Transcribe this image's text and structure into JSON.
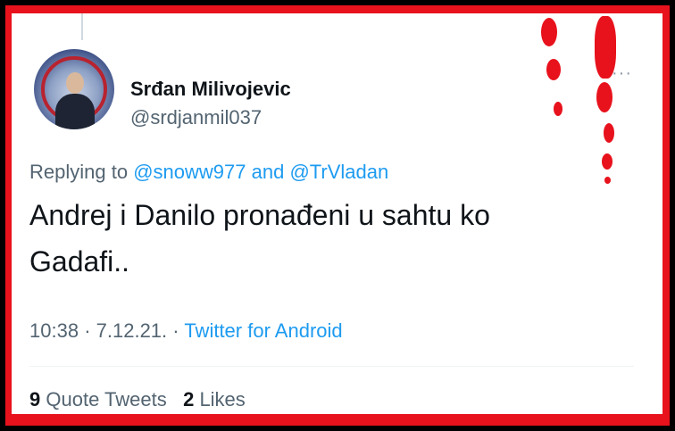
{
  "tweet": {
    "author_name": "Srđan Milivojevic",
    "author_handle": "@srdjanmil037",
    "more_icon": "···",
    "reply_prefix": "Replying to",
    "reply_mention_1": "@snoww977",
    "reply_and": "and",
    "reply_mention_2": "@TrVladan",
    "text_line_1": "Andrej i Danilo pronađeni u sahtu ko",
    "text_line_2": "Gadafi..",
    "time": "10:38",
    "date": "7.12.21.",
    "separator": "·",
    "source": "Twitter for Android",
    "quote_count": "9",
    "quote_label": "Quote Tweets",
    "like_count": "2",
    "like_label": "Likes"
  },
  "colors": {
    "frame_red": "#e8121c",
    "link_blue": "#1d9bf0",
    "secondary_text": "#536471",
    "primary_text": "#0f1419"
  }
}
